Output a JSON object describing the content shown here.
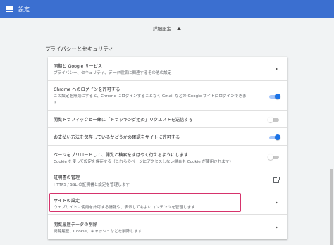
{
  "header": {
    "title": "設定",
    "menu_icon": "hamburger-menu-icon",
    "color": "#3b6fd0"
  },
  "advanced": {
    "label": "詳細設定",
    "icon": "caret-up-icon"
  },
  "privacy": {
    "section_title": "プライバシーとセキュリティ",
    "rows": [
      {
        "title": "同期と Google サービス",
        "desc": "プライバシー、セキュリティ、データ収集に関連するその他の設定",
        "control": "chevron-right-icon"
      },
      {
        "title": "Chrome へのログインを許可する",
        "desc1": "この設定を無効にすると、Chrome にログインすることなく Gmail などの Google サイトにログインできま",
        "desc2": "す",
        "control": "toggle",
        "state": "on"
      },
      {
        "title": "閲覧トラフィックと一緒に「トラッキング拒否」リクエストを送信する",
        "control": "toggle",
        "state": "off"
      },
      {
        "title": "お支払い方法を保存しているかどうかの確認をサイトに許可する",
        "control": "toggle",
        "state": "on"
      },
      {
        "title": "ページをプリロードして、閲覧と検索をすばやく行えるようにします",
        "desc": "Cookie を使って設定を保存する（これらのページにアクセスしない場合も Cookie が使用されます）",
        "control": "toggle",
        "state": "off"
      },
      {
        "title": "証明書の管理",
        "desc": "HTTPS / SSL の証明書と設定を管理します",
        "control": "external-link-icon"
      },
      {
        "title": "サイトの設定",
        "desc": "ウェブサイトに使用を許可する情報や、表示してもよいコンテンツを管理します",
        "control": "chevron-right-icon",
        "highlighted": true
      },
      {
        "title": "閲覧履歴データの削除",
        "desc": "閲覧履歴、Cookie、キャッシュなどを削除します",
        "control": "chevron-right-icon"
      }
    ]
  },
  "colors": {
    "toggle_on": "#1a73e8",
    "highlight_border": "#d6336c"
  }
}
